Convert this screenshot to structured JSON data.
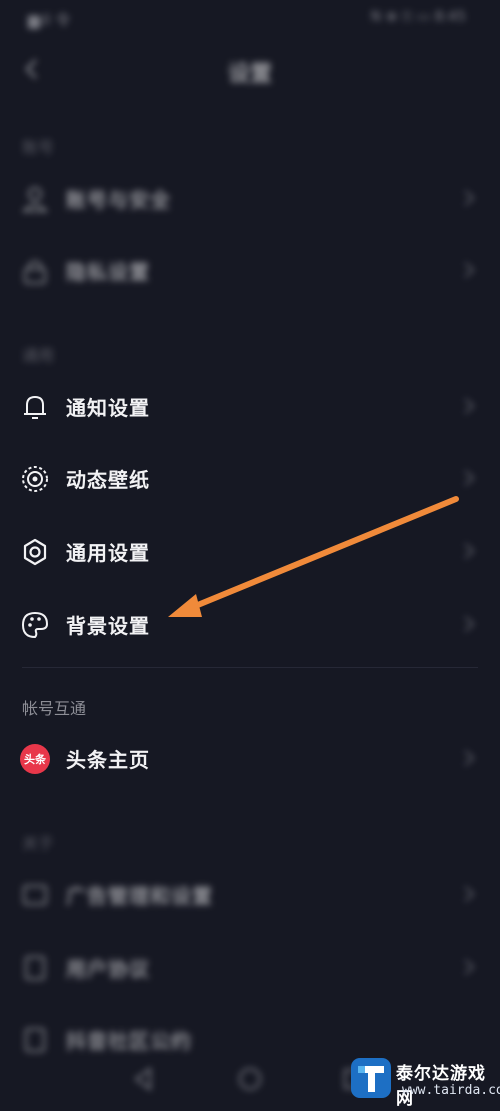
{
  "status_bar": {
    "left": "▆ᵢll 令",
    "right": "N ⊕ ⚿ ▭ 8:45"
  },
  "header": {
    "title": "设置"
  },
  "sections": {
    "account": {
      "label": "账号"
    },
    "general": {
      "label": "通用"
    },
    "linked": {
      "label": "帐号互通"
    },
    "about": {
      "label": "关于"
    }
  },
  "items": {
    "account_security": "账号与安全",
    "privacy": "隐私设置",
    "notifications": "通知设置",
    "live_wallpaper": "动态壁纸",
    "general_settings": "通用设置",
    "background_settings": "背景设置",
    "toutiao_homepage": "头条主页",
    "ad_settings": "广告管理和设置",
    "user_agreement": "用户协议",
    "community_convention": "抖音社区公约"
  },
  "toutiao_badge": "头条",
  "annotation": {
    "color": "#f08a3a"
  },
  "watermark": {
    "cn": "泰尔达游戏网",
    "url": "www.tairda.com"
  }
}
